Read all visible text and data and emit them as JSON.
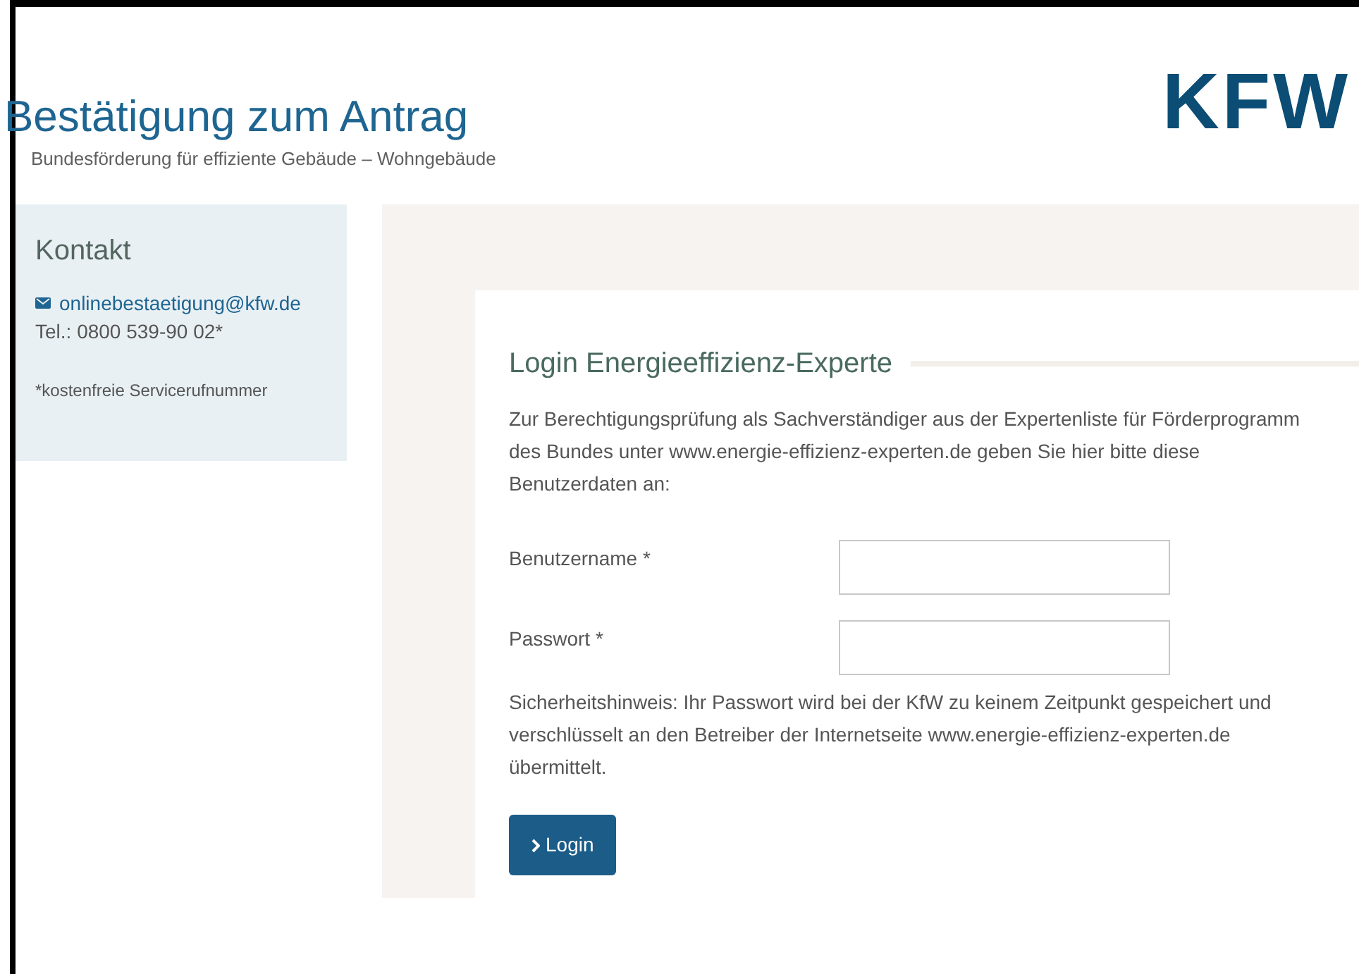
{
  "header": {
    "title": "Bestätigung zum Antrag",
    "subtitle": "Bundesförderung für effiziente Gebäude – Wohngebäude",
    "logo": "KFW"
  },
  "contact": {
    "title": "Kontakt",
    "email": "onlinebestaetigung@kfw.de",
    "phone": "Tel.: 0800 539-90 02*",
    "footnote": "*kostenfreie Servicerufnummer"
  },
  "login": {
    "title": "Login Energieeffizienz-Experte",
    "intro_lines": [
      "Zur Berechtigungsprüfung als Sachverständiger aus der Expertenliste für Förderprogramm",
      "des Bundes unter www.energie-effizienz-experten.de geben Sie hier bitte diese",
      "Benutzerdaten an:"
    ],
    "fields": [
      {
        "label": "Benutzername *"
      },
      {
        "label": "Passwort *"
      }
    ],
    "notice_lines": [
      "Sicherheitshinweis: Ihr Passwort wird bei der KfW zu keinem Zeitpunkt gespeichert und",
      "verschlüsselt an den Betreiber der Internetseite www.energie-effizienz-experten.de",
      "übermittelt."
    ],
    "button": "Login"
  }
}
